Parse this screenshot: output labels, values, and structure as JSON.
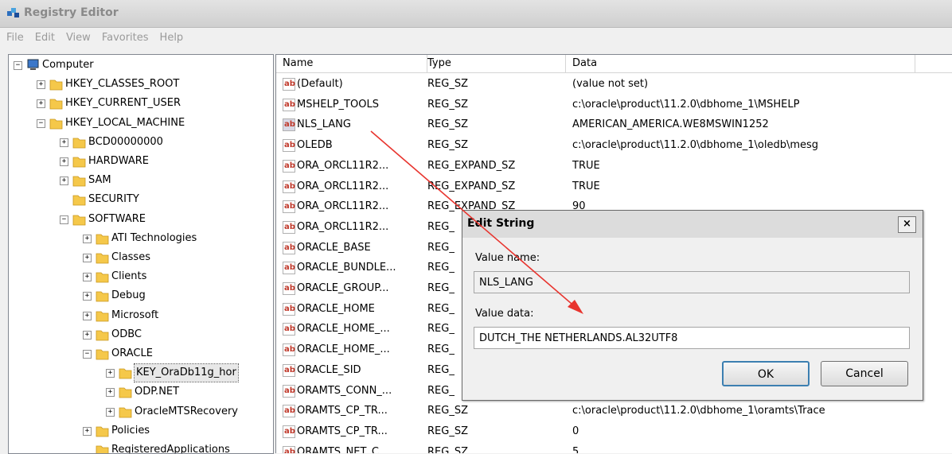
{
  "window": {
    "title": "Registry Editor"
  },
  "menu": [
    "File",
    "Edit",
    "View",
    "Favorites",
    "Help"
  ],
  "tree": [
    {
      "label": "Computer",
      "toggle": "−"
    },
    {
      "label": "HKEY_CLASSES_ROOT",
      "toggle": "+"
    },
    {
      "label": "HKEY_CURRENT_USER",
      "toggle": "+"
    },
    {
      "label": "HKEY_LOCAL_MACHINE",
      "toggle": "−"
    },
    {
      "label": "BCD00000000",
      "toggle": "+"
    },
    {
      "label": "HARDWARE",
      "toggle": "+"
    },
    {
      "label": "SAM",
      "toggle": "+"
    },
    {
      "label": "SECURITY",
      "toggle": ""
    },
    {
      "label": "SOFTWARE",
      "toggle": "−"
    },
    {
      "label": "ATI Technologies",
      "toggle": "+"
    },
    {
      "label": "Classes",
      "toggle": "+"
    },
    {
      "label": "Clients",
      "toggle": "+"
    },
    {
      "label": "Debug",
      "toggle": "+"
    },
    {
      "label": "Microsoft",
      "toggle": "+"
    },
    {
      "label": "ODBC",
      "toggle": "+"
    },
    {
      "label": "ORACLE",
      "toggle": "−"
    },
    {
      "label": "KEY_OraDb11g_hor",
      "toggle": "+"
    },
    {
      "label": "ODP.NET",
      "toggle": "+"
    },
    {
      "label": "OracleMTSRecovery",
      "toggle": "+"
    },
    {
      "label": "Policies",
      "toggle": "+"
    },
    {
      "label": "RegisteredApplications",
      "toggle": ""
    }
  ],
  "list": {
    "headers": [
      "Name",
      "Type",
      "Data"
    ],
    "rows": [
      {
        "name": "(Default)",
        "type": "REG_SZ",
        "data": "(value not set)"
      },
      {
        "name": "MSHELP_TOOLS",
        "type": "REG_SZ",
        "data": "c:\\oracle\\product\\11.2.0\\dbhome_1\\MSHELP"
      },
      {
        "name": "NLS_LANG",
        "type": "REG_SZ",
        "data": "AMERICAN_AMERICA.WE8MSWIN1252"
      },
      {
        "name": "OLEDB",
        "type": "REG_SZ",
        "data": "c:\\oracle\\product\\11.2.0\\dbhome_1\\oledb\\mesg"
      },
      {
        "name": "ORA_ORCL11R2...",
        "type": "REG_EXPAND_SZ",
        "data": "TRUE"
      },
      {
        "name": "ORA_ORCL11R2...",
        "type": "REG_EXPAND_SZ",
        "data": "TRUE"
      },
      {
        "name": "ORA_ORCL11R2...",
        "type": "REG_EXPAND_SZ",
        "data": "90"
      },
      {
        "name": "ORA_ORCL11R2...",
        "type": "REG_",
        "data": ""
      },
      {
        "name": "ORACLE_BASE",
        "type": "REG_",
        "data": ""
      },
      {
        "name": "ORACLE_BUNDLE...",
        "type": "REG_",
        "data": ""
      },
      {
        "name": "ORACLE_GROUP...",
        "type": "REG_",
        "data": ""
      },
      {
        "name": "ORACLE_HOME",
        "type": "REG_",
        "data": ""
      },
      {
        "name": "ORACLE_HOME_...",
        "type": "REG_",
        "data": ""
      },
      {
        "name": "ORACLE_HOME_...",
        "type": "REG_",
        "data": ""
      },
      {
        "name": "ORACLE_SID",
        "type": "REG_",
        "data": ""
      },
      {
        "name": "ORAMTS_CONN_...",
        "type": "REG_",
        "data": ""
      },
      {
        "name": "ORAMTS_CP_TR...",
        "type": "REG_SZ",
        "data": "c:\\oracle\\product\\11.2.0\\dbhome_1\\oramts\\Trace"
      },
      {
        "name": "ORAMTS_CP_TR...",
        "type": "REG_SZ",
        "data": "0"
      },
      {
        "name": "ORAMTS_NET_C...",
        "type": "REG_SZ",
        "data": "5"
      }
    ]
  },
  "dialog": {
    "title": "Edit String",
    "close": "×",
    "value_name_label": "Value name:",
    "value_name": "NLS_LANG",
    "value_data_label": "Value data:",
    "value_data": "DUTCH_THE NETHERLANDS.AL32UTF8",
    "ok": "OK",
    "cancel": "Cancel"
  },
  "colors": {
    "folder": "#f5c84a",
    "string_icon": "#c0392b",
    "annotation_arrow": "#e8342e",
    "selection": "#3399ff"
  },
  "icons": {
    "tree_item": "folder-icon",
    "value_item": "string-value-icon",
    "window": "registry-editor-icon"
  }
}
